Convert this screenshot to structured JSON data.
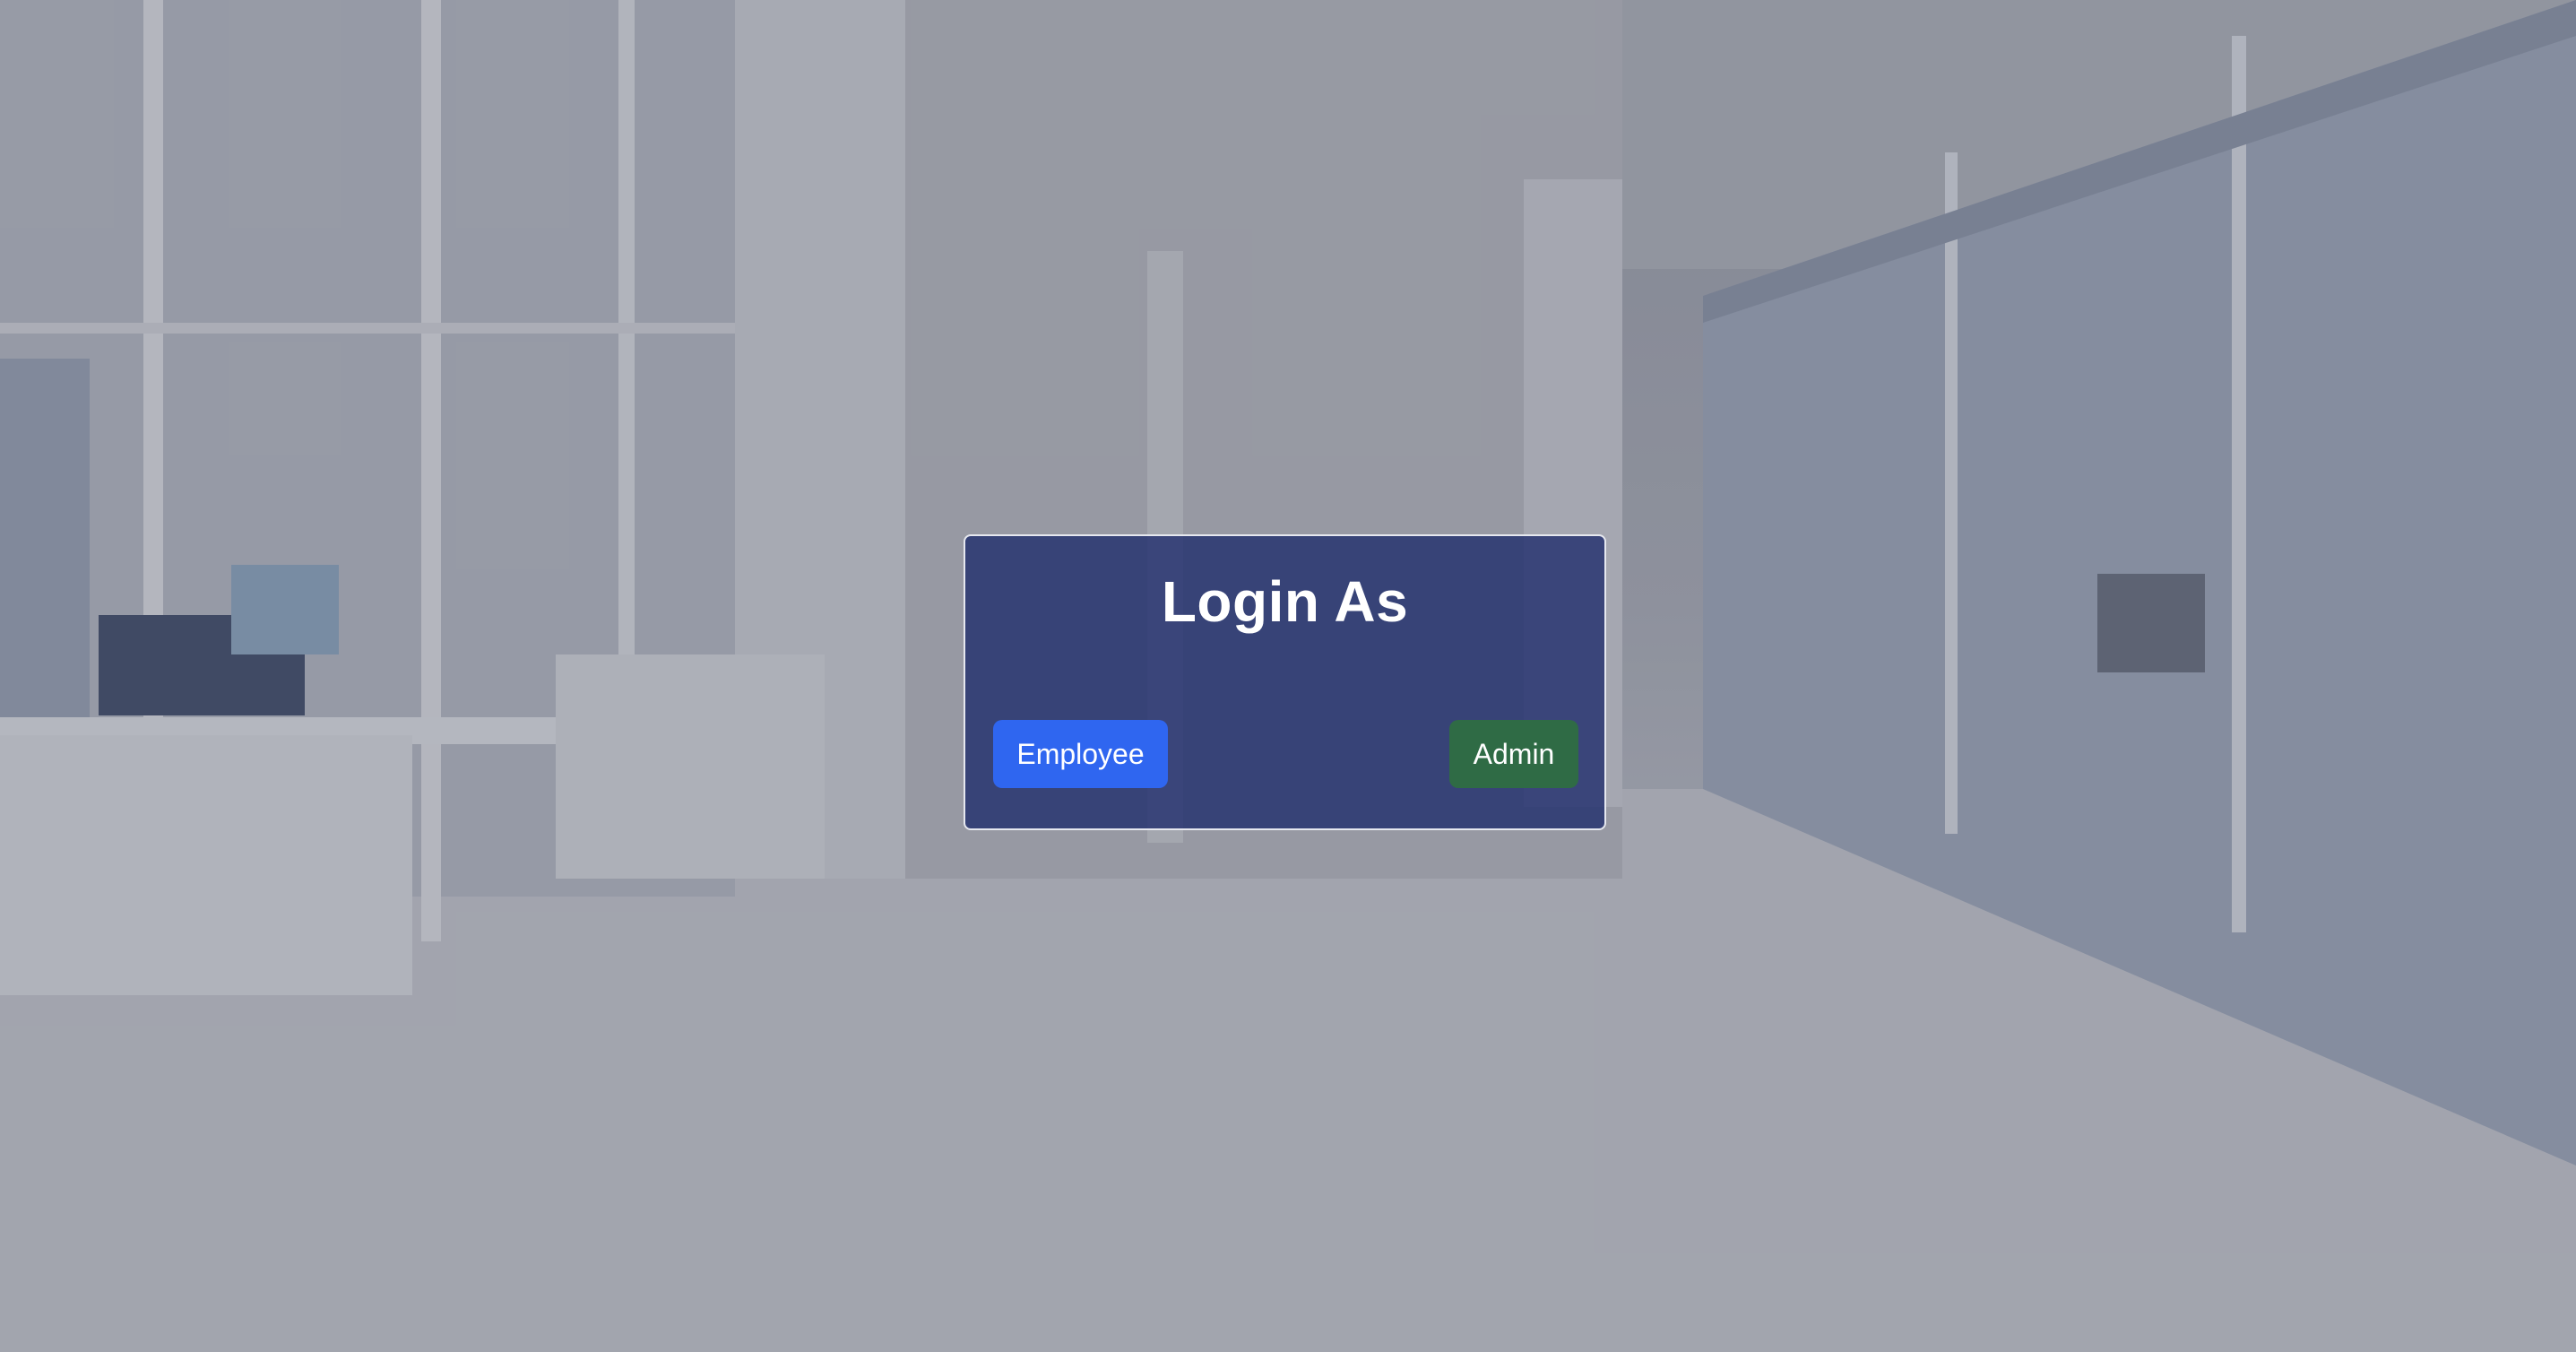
{
  "login": {
    "title": "Login As",
    "employee_label": "Employee",
    "admin_label": "Admin"
  },
  "colors": {
    "card_background": "#22306e",
    "employee_button": "#2f66f0",
    "admin_button": "#2f6b45",
    "text": "#ffffff"
  }
}
